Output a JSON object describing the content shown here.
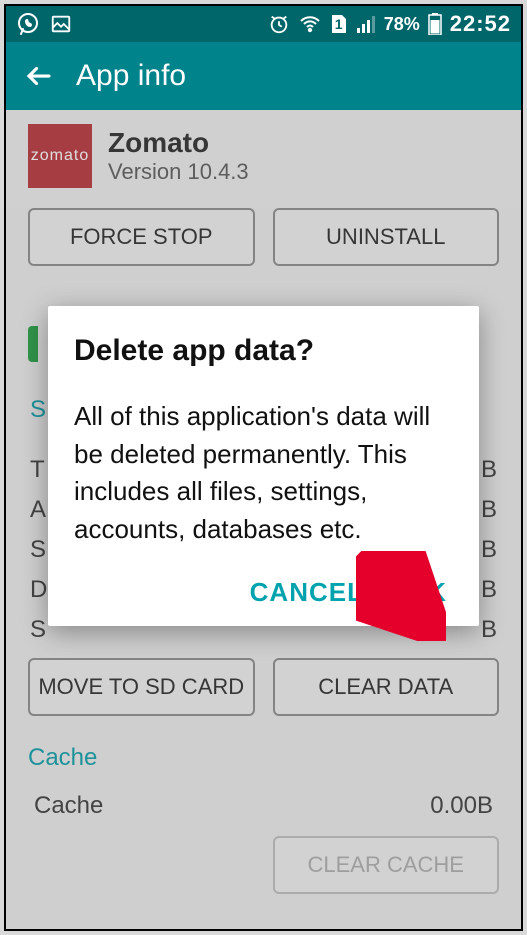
{
  "statusbar": {
    "battery": "78%",
    "time": "22:52",
    "sim_label": "1"
  },
  "header": {
    "title": "App info"
  },
  "app": {
    "name": "Zomato",
    "version": "Version 10.4.3",
    "icon_text": "zomato"
  },
  "buttons": {
    "force_stop": "FORCE STOP",
    "uninstall": "UNINSTALL",
    "move_sd": "MOVE TO SD CARD",
    "clear_data": "CLEAR DATA",
    "clear_cache": "CLEAR CACHE"
  },
  "storage": {
    "section_letter": "S",
    "rows": [
      {
        "k": "T",
        "v": "B"
      },
      {
        "k": "A",
        "v": "B"
      },
      {
        "k": "S",
        "v": "B"
      },
      {
        "k": "D",
        "v": "B"
      },
      {
        "k": "S",
        "v": "B"
      }
    ]
  },
  "cache": {
    "label": "Cache",
    "row_label": "Cache",
    "row_value": "0.00B"
  },
  "dialog": {
    "title": "Delete app data?",
    "body": "All of this application's data will be deleted permanently. This includes all files, settings, accounts, databases etc.",
    "cancel": "CANCEL",
    "ok": "OK"
  },
  "colors": {
    "teal_dark": "#00666a",
    "teal": "#00838a",
    "accent": "#00a2ae",
    "zomato": "#b42b33",
    "arrow": "#e4002b"
  }
}
